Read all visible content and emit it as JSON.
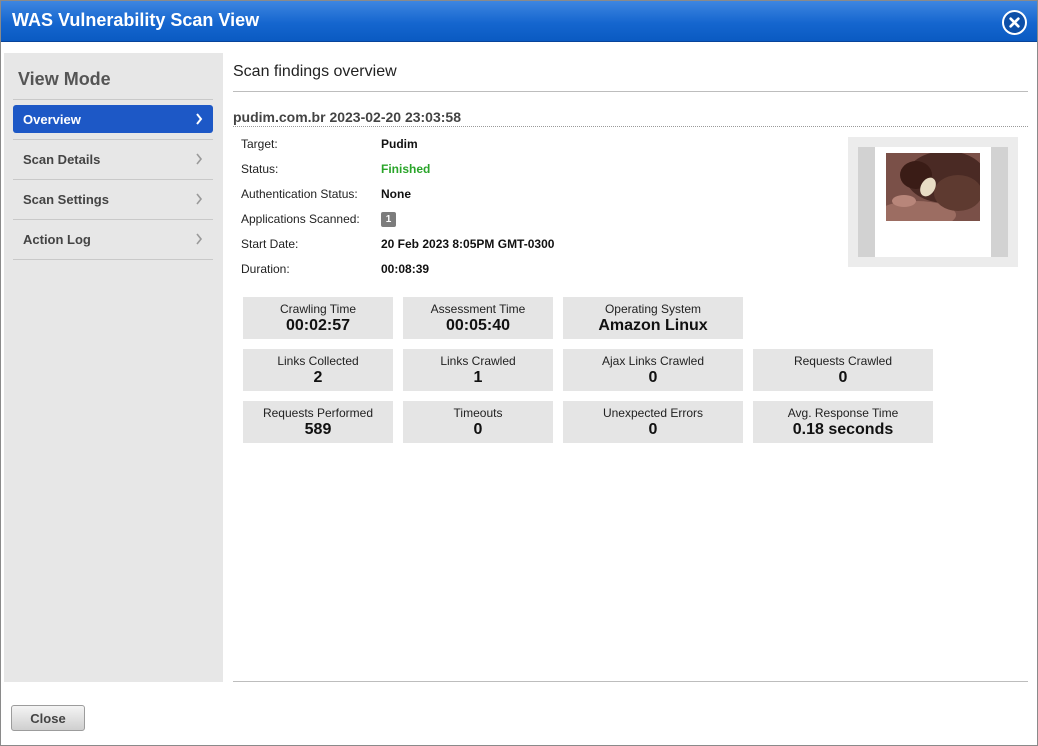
{
  "window": {
    "title": "WAS Vulnerability Scan View"
  },
  "sidebar": {
    "heading": "View Mode",
    "items": [
      {
        "label": "Overview",
        "active": true
      },
      {
        "label": "Scan Details",
        "active": false
      },
      {
        "label": "Scan Settings",
        "active": false
      },
      {
        "label": "Action Log",
        "active": false
      }
    ]
  },
  "main": {
    "section_title": "Scan findings overview",
    "scan_name": "pudim.com.br 2023-02-20 23:03:58",
    "details": [
      {
        "label": "Target:",
        "value": "Pudim"
      },
      {
        "label": "Status:",
        "value": "Finished",
        "color": "#2aa52a"
      },
      {
        "label": "Authentication Status:",
        "value": "None"
      },
      {
        "label": "Applications Scanned:",
        "value": "1"
      },
      {
        "label": "Start Date:",
        "value": "20 Feb 2023 8:05PM GMT-0300"
      },
      {
        "label": "Duration:",
        "value": "00:08:39"
      }
    ],
    "stats": [
      {
        "label": "Crawling Time",
        "value": "00:02:57"
      },
      {
        "label": "Assessment Time",
        "value": "00:05:40"
      },
      {
        "label": "Operating System",
        "value": "Amazon Linux"
      },
      {
        "label": "Links Collected",
        "value": "2"
      },
      {
        "label": "Links Crawled",
        "value": "1"
      },
      {
        "label": "Ajax Links Crawled",
        "value": "0"
      },
      {
        "label": "Requests Crawled",
        "value": "0"
      },
      {
        "label": "Requests Performed",
        "value": "589"
      },
      {
        "label": "Timeouts",
        "value": "0"
      },
      {
        "label": "Unexpected Errors",
        "value": "0"
      },
      {
        "label": "Avg. Response Time",
        "value": "0.18 seconds"
      }
    ]
  },
  "footer": {
    "close_label": "Close"
  },
  "icons": {
    "window_close": "close-icon",
    "nav_arrow": "chevron-right-icon"
  },
  "colors": {
    "titlebar": "#1566cf",
    "active_nav": "#1d58c6",
    "status_finished": "#2aa52a"
  }
}
